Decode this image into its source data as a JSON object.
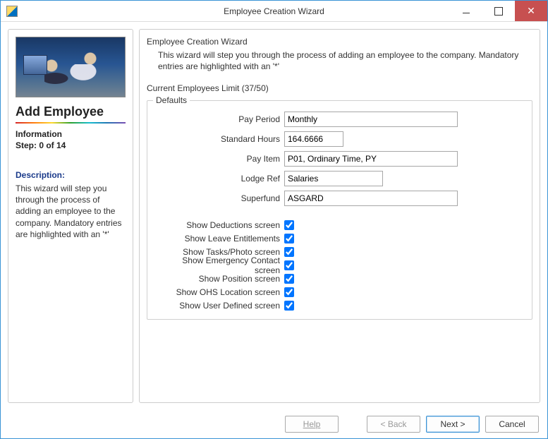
{
  "window": {
    "title": "Employee Creation Wizard"
  },
  "left": {
    "heading": "Add Employee",
    "info_label": "Information",
    "step_label": "Step: 0 of 14",
    "desc_head": "Description:",
    "desc_text": "This wizard will step you through the process of adding an employee to the company. Mandatory entries are highlighted with an '*'"
  },
  "right": {
    "title": "Employee Creation Wizard",
    "intro": "This wizard will step you through the process of adding an employee to the company. Mandatory entries are highlighted with an '*'",
    "limit": "Current Employees Limit (37/50)",
    "defaults_legend": "Defaults",
    "fields": {
      "pay_period_label": "Pay Period",
      "pay_period_value": "Monthly",
      "std_hours_label": "Standard Hours",
      "std_hours_value": "164.6666",
      "pay_item_label": "Pay Item",
      "pay_item_value": "P01, Ordinary Time, PY",
      "lodge_ref_label": "Lodge Ref",
      "lodge_ref_value": "Salaries",
      "superfund_label": "Superfund",
      "superfund_value": "ASGARD"
    },
    "checks": [
      {
        "label": "Show Deductions screen",
        "checked": true
      },
      {
        "label": "Show Leave Entitlements",
        "checked": true
      },
      {
        "label": "Show Tasks/Photo screen",
        "checked": true
      },
      {
        "label": "Show Emergency Contact screen",
        "checked": true
      },
      {
        "label": "Show Position screen",
        "checked": true
      },
      {
        "label": "Show OHS Location screen",
        "checked": true
      },
      {
        "label": "Show User Defined screen",
        "checked": true
      }
    ]
  },
  "footer": {
    "help": "Help",
    "back": "< Back",
    "next": "Next >",
    "cancel": "Cancel"
  }
}
